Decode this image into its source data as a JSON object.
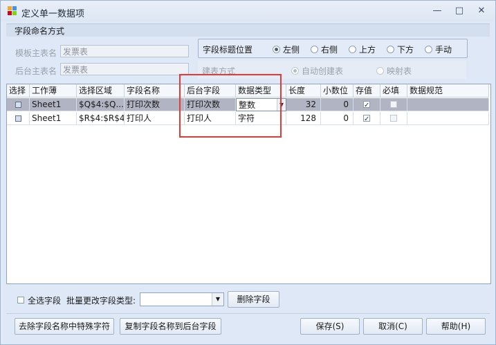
{
  "window": {
    "title": "定义单一数据项"
  },
  "naming": {
    "section_title": "字段命名方式",
    "template_table_label": "模板主表名",
    "template_table_value": "发票表",
    "backend_table_label": "后台主表名",
    "backend_table_value": "发票表"
  },
  "title_position": {
    "label": "字段标题位置",
    "options": [
      "左侧",
      "右侧",
      "上方",
      "下方",
      "手动"
    ],
    "selected": "左侧"
  },
  "build_mode": {
    "label": "建表方式",
    "options": [
      "自动创建表",
      "映射表"
    ],
    "selected": "自动创建表"
  },
  "grid": {
    "columns": [
      "选择",
      "工作薄",
      "选择区域",
      "字段名称",
      "后台字段",
      "数据类型",
      "长度",
      "小数位",
      "存值",
      "必填",
      "数据规范"
    ],
    "rows": [
      {
        "workbook": "Sheet1",
        "range": "$Q$4:$Q...",
        "field_name": "打印次数",
        "backend_field": "打印次数",
        "data_type": "整数",
        "length": "32",
        "decimals": "0",
        "store": true,
        "required": false,
        "spec": ""
      },
      {
        "workbook": "Sheet1",
        "range": "$R$4:$R$4",
        "field_name": "打印人",
        "backend_field": "打印人",
        "data_type": "字符",
        "length": "128",
        "decimals": "0",
        "store": true,
        "required": false,
        "spec": ""
      }
    ]
  },
  "batch": {
    "select_all_label": "全选字段",
    "change_type_label": "批量更改字段类型:",
    "change_type_value": "",
    "delete_label": "删除字段"
  },
  "footer": {
    "remove_special_label": "去除字段名称中特殊字符",
    "copy_names_label": "复制字段名称到后台字段",
    "save_label": "保存(S)",
    "cancel_label": "取消(C)",
    "help_label": "帮助(H)"
  },
  "colors": {
    "highlight": "#e53935",
    "selected_row": "#b1b5c3",
    "window_bg": "#dfe8f6"
  }
}
